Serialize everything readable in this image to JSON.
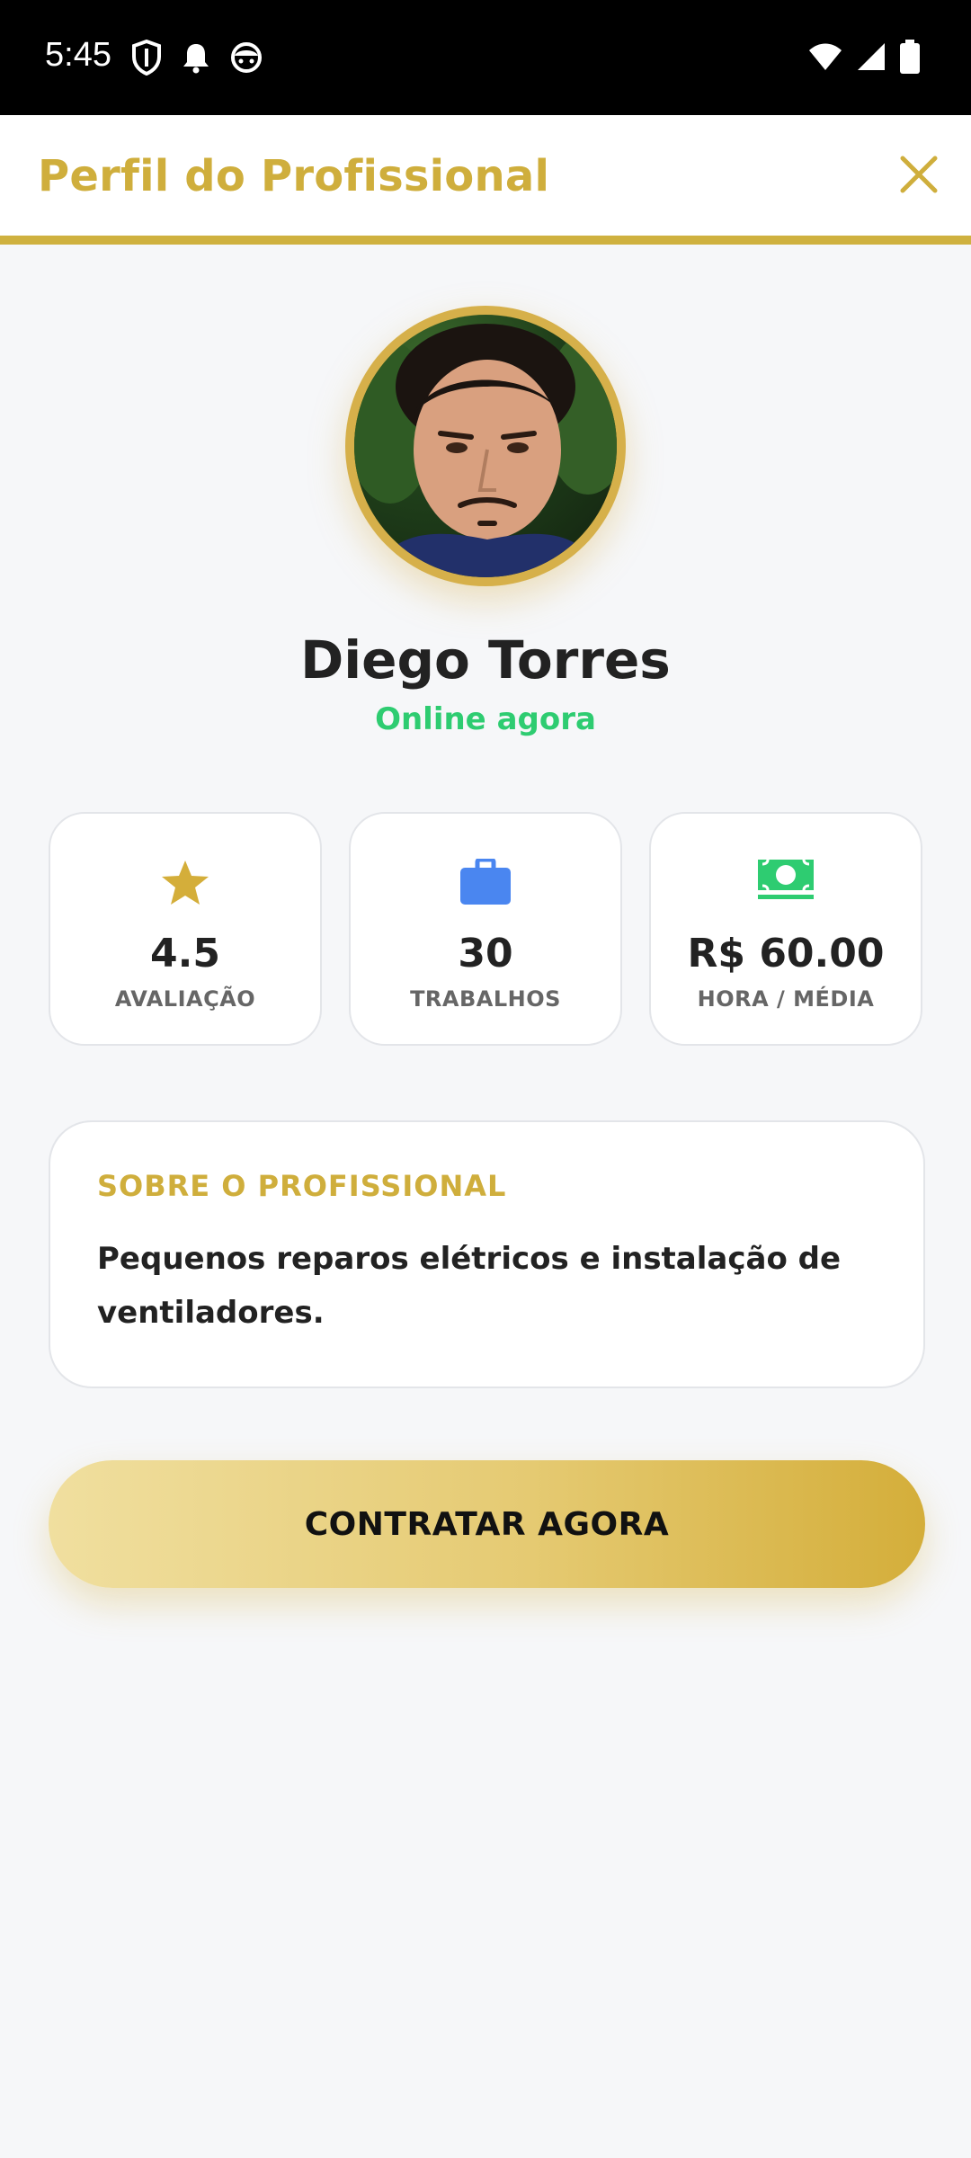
{
  "status_bar": {
    "time": "5:45",
    "left_icons": [
      "shield-icon",
      "bell-icon",
      "android-face-icon"
    ],
    "right_icons": [
      "wifi-icon",
      "signal-icon",
      "battery-icon"
    ]
  },
  "header": {
    "title": "Perfil do Profissional",
    "accent_color": "#cfae3c"
  },
  "profile": {
    "name": "Diego Torres",
    "status": "Online agora",
    "status_color": "#2ecc71"
  },
  "stats": [
    {
      "icon": "star-icon",
      "value": "4.5",
      "label": "AVALIAÇÃO",
      "color": "#d4ae3a"
    },
    {
      "icon": "briefcase-icon",
      "value": "30",
      "label": "TRABALHOS",
      "color": "#4a86f0"
    },
    {
      "icon": "money-icon",
      "value": "R$ 60.00",
      "label": "HORA / MÉDIA",
      "color": "#2ecc71"
    }
  ],
  "about": {
    "title": "SOBRE O PROFISSIONAL",
    "text": "Pequenos reparos elétricos e instalação de ventiladores."
  },
  "cta": {
    "label": "CONTRATAR AGORA"
  }
}
